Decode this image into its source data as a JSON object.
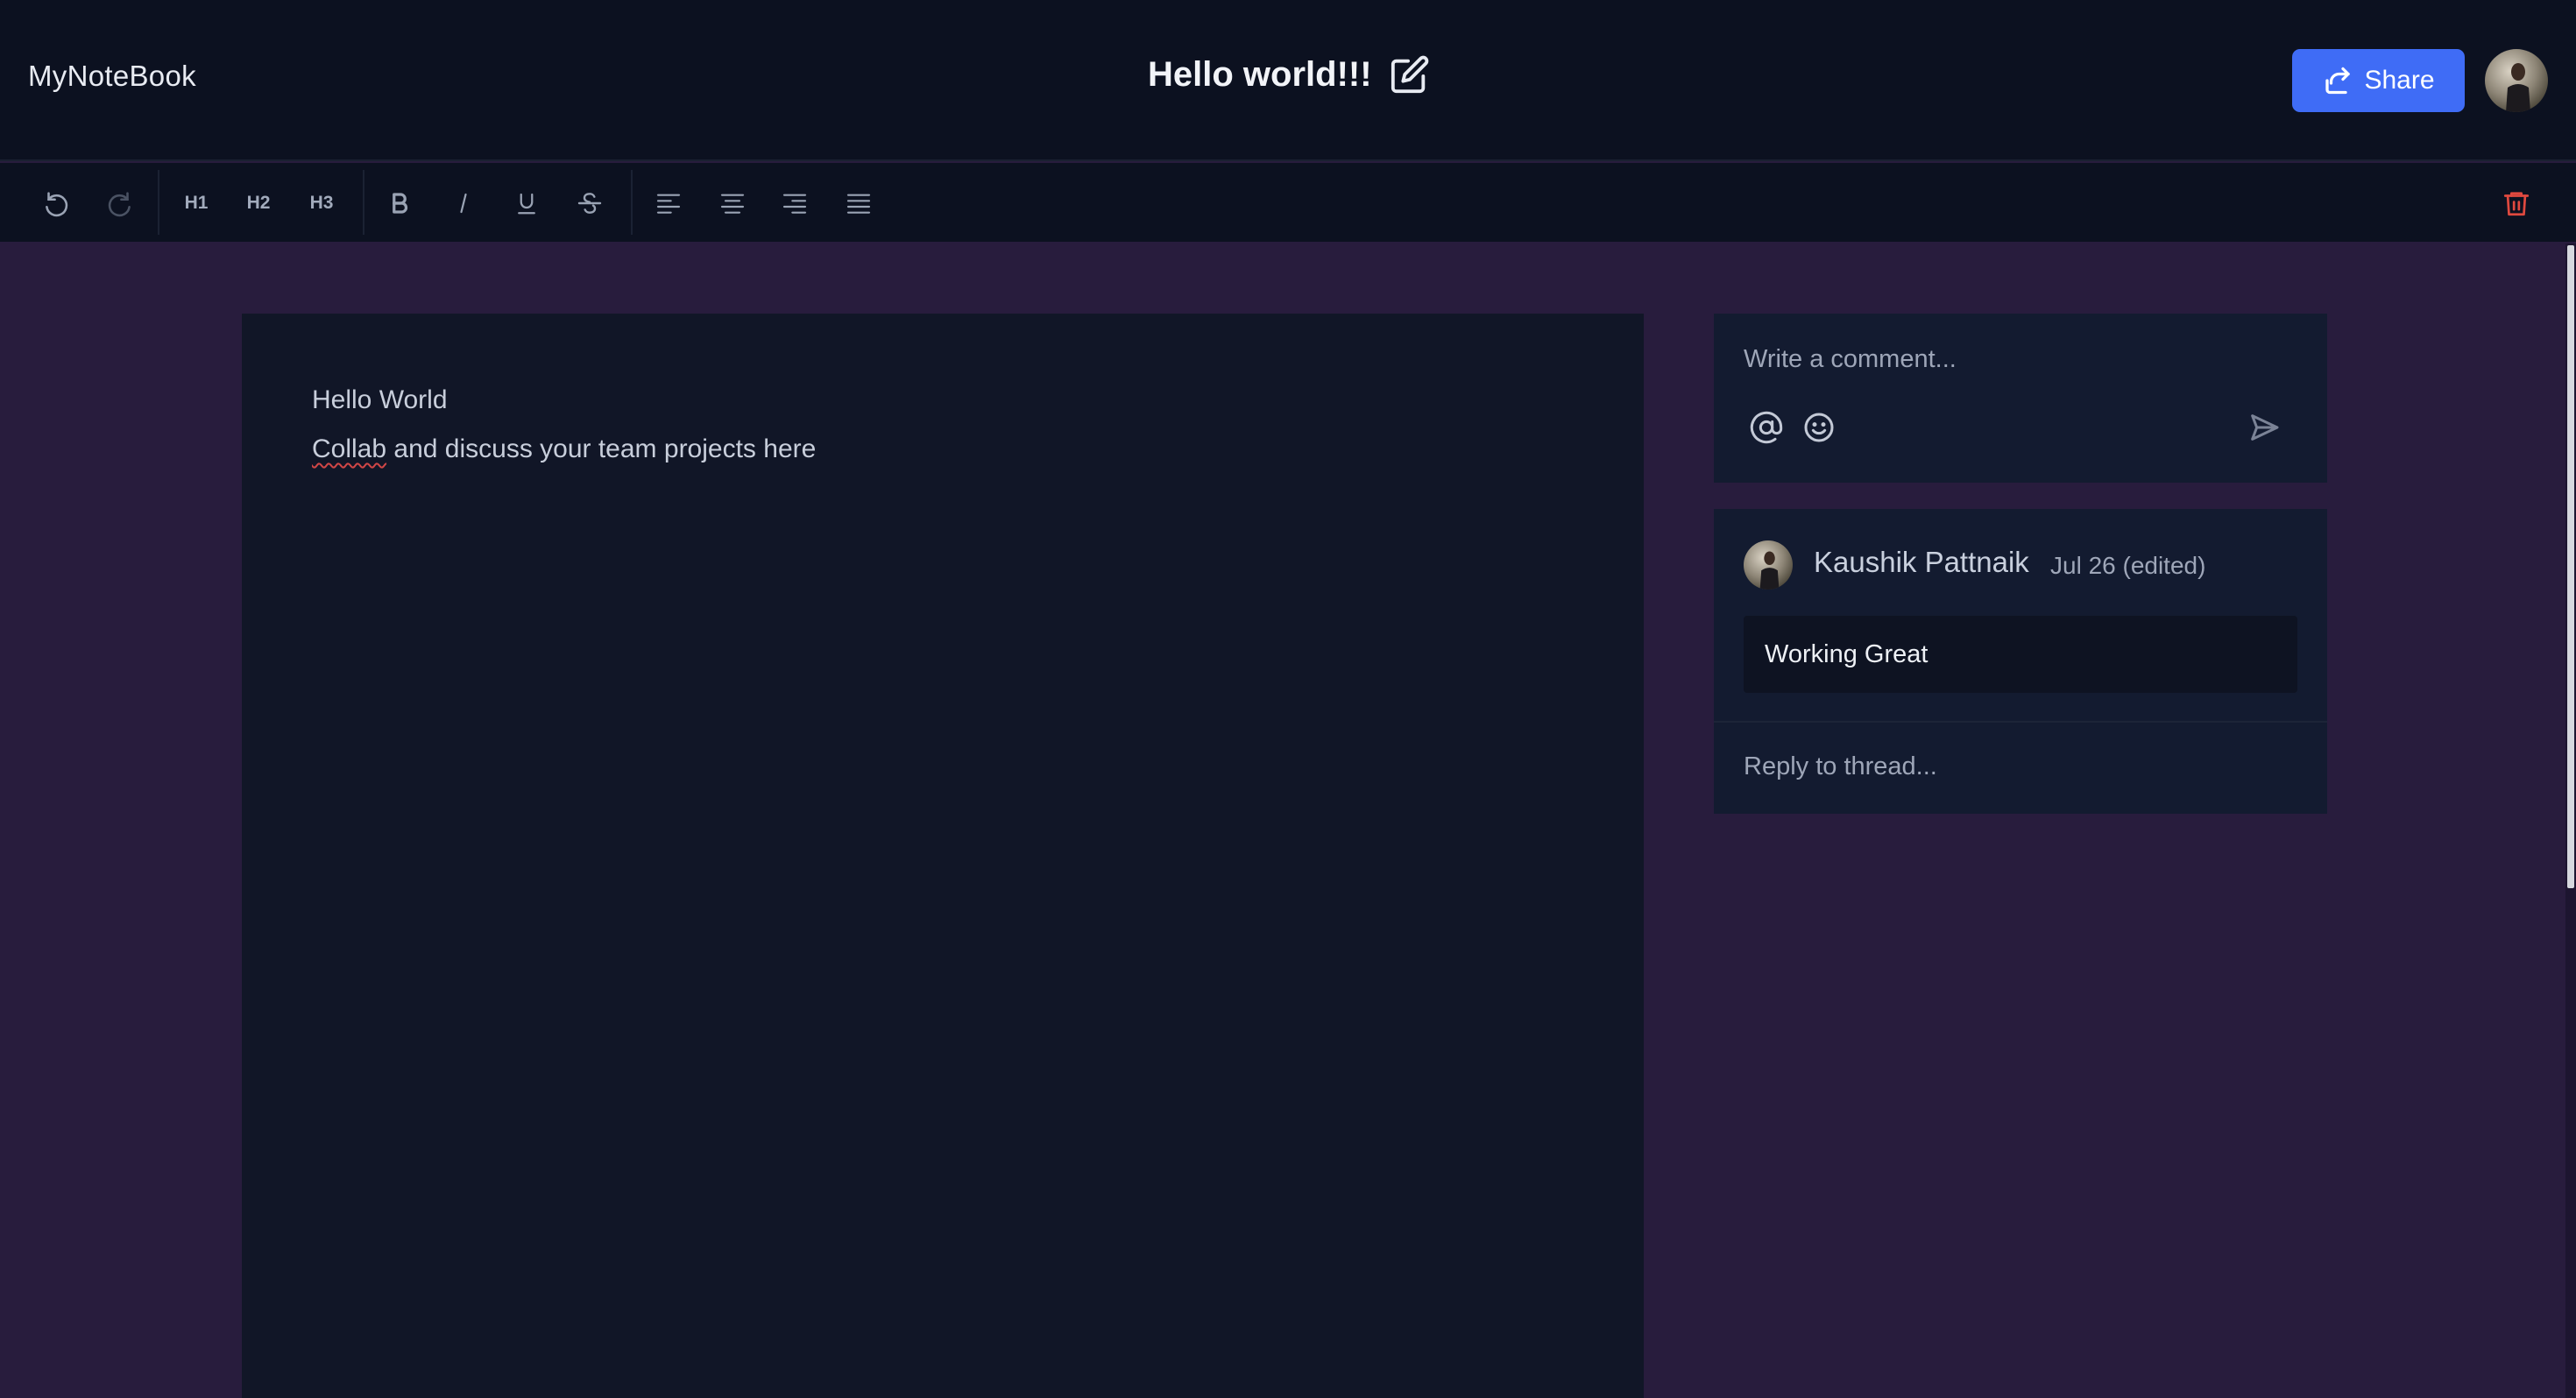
{
  "app": {
    "brand": "MyNoteBook"
  },
  "document": {
    "title": "Hello world!!!"
  },
  "header": {
    "share_label": "Share"
  },
  "toolbar": {
    "items": [
      {
        "label": "",
        "icon": "undo-icon"
      },
      {
        "label": "",
        "icon": "redo-icon"
      },
      {
        "label": "H1"
      },
      {
        "label": "H2"
      },
      {
        "label": "H3"
      },
      {
        "label": "",
        "icon": "bold-icon"
      },
      {
        "label": "",
        "icon": "italic-icon"
      },
      {
        "label": "",
        "icon": "underline-icon"
      },
      {
        "label": "",
        "icon": "strikethrough-icon"
      },
      {
        "label": "",
        "icon": "align-left-icon"
      },
      {
        "label": "",
        "icon": "align-center-icon"
      },
      {
        "label": "",
        "icon": "align-right-icon"
      },
      {
        "label": "",
        "icon": "align-justify-icon"
      },
      {
        "label": "",
        "icon": "trash-icon"
      }
    ]
  },
  "editor": {
    "lines": [
      {
        "text": "Hello World"
      },
      {
        "misspelled": "Collab",
        "text": " and discuss your team projects here"
      }
    ]
  },
  "comments": {
    "input_placeholder": "Write a comment...",
    "threads": [
      {
        "author": "Kaushik Pattnaik",
        "meta": "Jul 26 (edited)",
        "message": "Working Great",
        "reply_placeholder": "Reply to thread..."
      }
    ]
  },
  "colors": {
    "accent": "#3f6cf6",
    "danger": "#e0493f",
    "background": "#281c3d",
    "panel": "#0c1120"
  }
}
